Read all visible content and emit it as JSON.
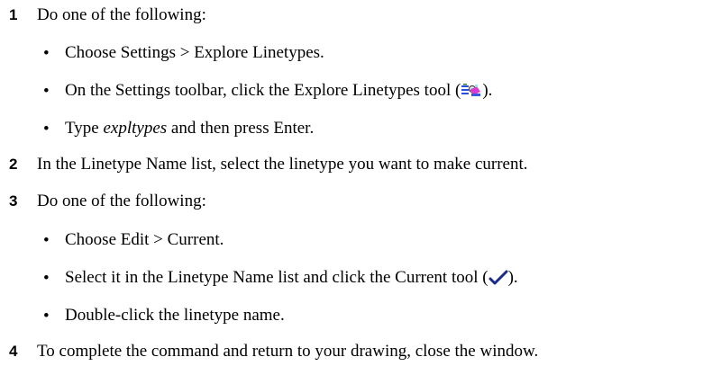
{
  "steps": [
    {
      "number": "1",
      "text": "Do one of the following:",
      "bullets": [
        {
          "text": "Choose Settings > Explore Linetypes."
        },
        {
          "before": "On the Settings toolbar, click the Explore Linetypes tool (",
          "icon": "explore-linetypes-icon",
          "after": ")."
        },
        {
          "before": "Type ",
          "italic": "expltypes",
          "after": " and then press Enter."
        }
      ]
    },
    {
      "number": "2",
      "text": "In the Linetype Name list, select the linetype you want to make current."
    },
    {
      "number": "3",
      "text": "Do one of the following:",
      "bullets": [
        {
          "text": "Choose Edit > Current."
        },
        {
          "before": "Select it in the Linetype Name list and click the Current tool (",
          "icon": "checkmark-icon",
          "after": ")."
        },
        {
          "text": "Double-click the linetype name."
        }
      ]
    },
    {
      "number": "4",
      "text": "To complete the command and return to your drawing, close the window."
    }
  ]
}
